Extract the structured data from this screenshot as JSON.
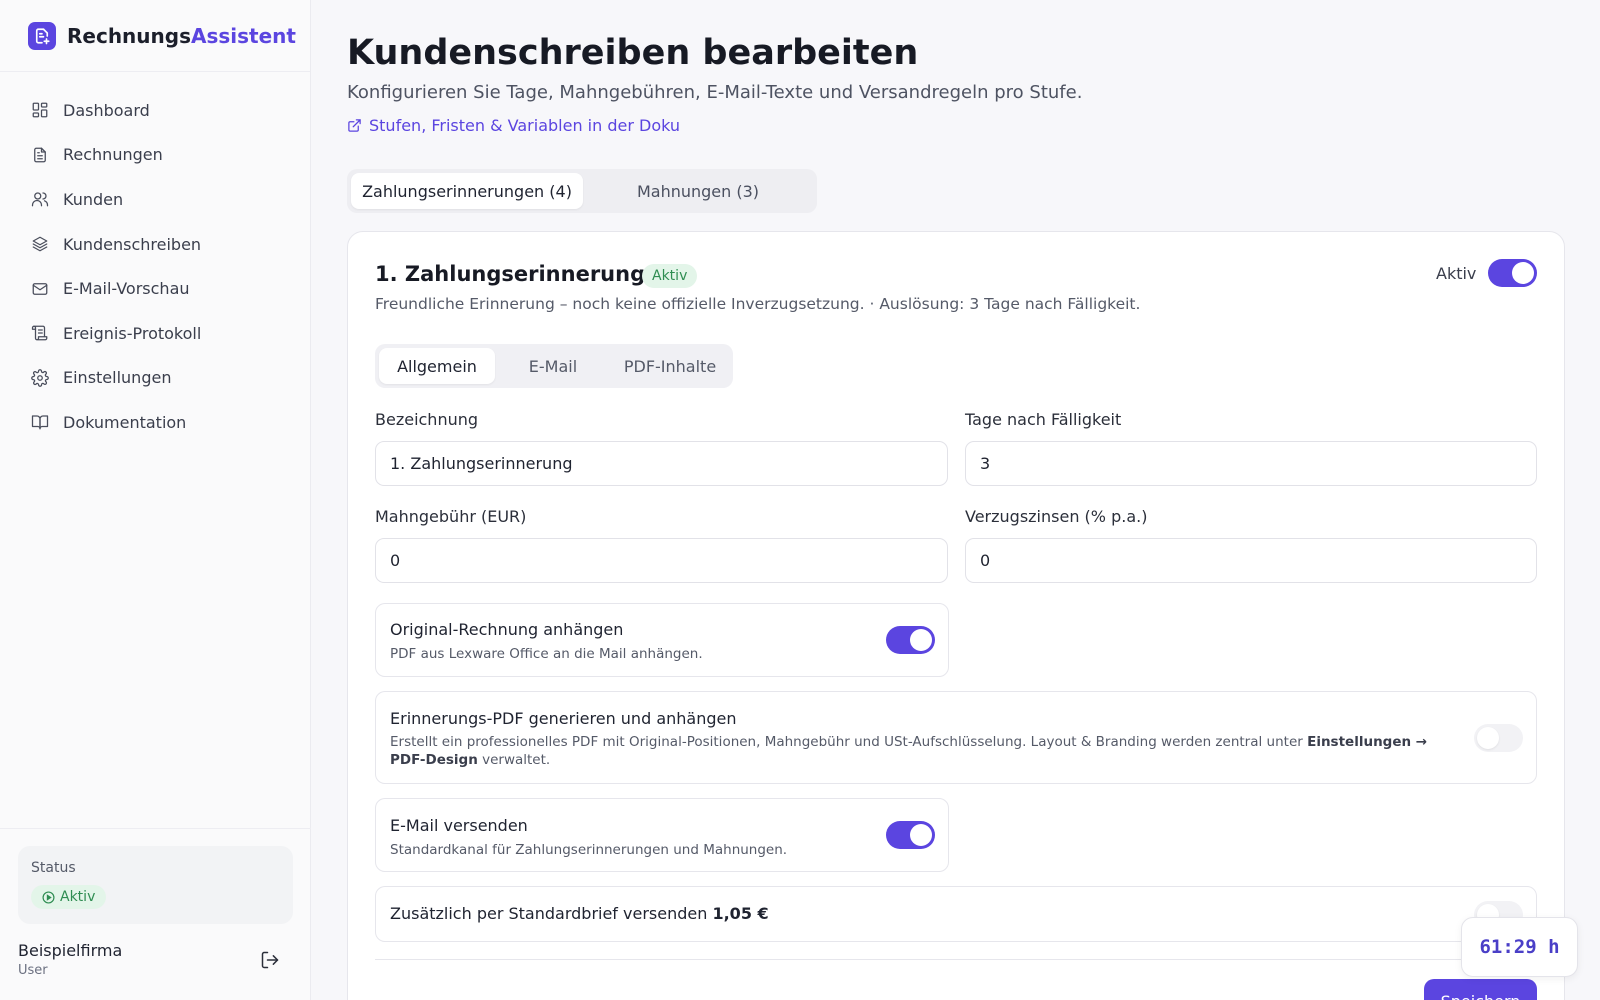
{
  "brand": {
    "name_part1": "Rechnungs",
    "name_part2": "Assistent",
    "logo_icon": "document-plus-icon"
  },
  "sidebar": {
    "items": [
      {
        "label": "Dashboard",
        "icon": "dashboard-icon"
      },
      {
        "label": "Rechnungen",
        "icon": "document-icon"
      },
      {
        "label": "Kunden",
        "icon": "users-icon"
      },
      {
        "label": "Kundenschreiben",
        "icon": "layers-icon"
      },
      {
        "label": "E-Mail-Vorschau",
        "icon": "mail-icon"
      },
      {
        "label": "Ereignis-Protokoll",
        "icon": "scroll-icon"
      },
      {
        "label": "Einstellungen",
        "icon": "gear-icon"
      },
      {
        "label": "Dokumentation",
        "icon": "book-icon"
      }
    ],
    "status": {
      "title": "Status",
      "value": "Aktiv"
    },
    "user": {
      "name": "Beispielfirma",
      "role": "User"
    }
  },
  "page": {
    "title": "Kundenschreiben bearbeiten",
    "subtitle": "Konfigurieren Sie Tage, Mahngebühren, E-Mail-Texte und Versandregeln pro Stufe.",
    "doc_link": "Stufen, Fristen & Variablen in der Doku"
  },
  "tabs": [
    {
      "label": "Zahlungserinnerungen (4)",
      "active": true
    },
    {
      "label": "Mahnungen (3)",
      "active": false
    }
  ],
  "card": {
    "title": "1. Zahlungserinnerung",
    "badge": "Aktiv",
    "description": "Freundliche Erinnerung – noch keine offizielle Inverzugsetzung. · Auslösung: 3 Tage nach Fälligkeit.",
    "active_label": "Aktiv",
    "active": true,
    "subtabs": [
      {
        "label": "Allgemein",
        "active": true
      },
      {
        "label": "E-Mail",
        "active": false
      },
      {
        "label": "PDF-Inhalte",
        "active": false
      }
    ],
    "fields": {
      "bezeichnung": {
        "label": "Bezeichnung",
        "value": "1. Zahlungserinnerung"
      },
      "tage": {
        "label": "Tage nach Fälligkeit",
        "value": "3"
      },
      "gebuehr": {
        "label": "Mahngebühr (EUR)",
        "value": "0"
      },
      "zinsen": {
        "label": "Verzugszinsen (% p.a.)",
        "value": "0"
      }
    },
    "options": {
      "attach_original": {
        "title": "Original-Rechnung anhängen",
        "desc": "PDF aus Lexware Office an die Mail anhängen.",
        "enabled": true
      },
      "reminder_pdf": {
        "title": "Erinnerungs-PDF generieren und anhängen",
        "desc_pre": "Erstellt ein professionelles PDF mit Original-Positionen, Mahngebühr und USt-Aufschlüsselung. Layout & Branding werden zentral unter ",
        "desc_bold": "Einstellungen → PDF-Design",
        "desc_post": " verwaltet.",
        "enabled": false
      },
      "send_email": {
        "title": "E-Mail versenden",
        "desc": "Standardkanal für Zahlungserinnerungen und Mahnungen.",
        "enabled": true
      },
      "letter": {
        "title_pre": "Zusätzlich per Standardbrief versenden ",
        "price": "1,05 €",
        "enabled": false
      }
    },
    "save_label": "Speichern"
  },
  "timer": "61:29 h",
  "colors": {
    "accent": "#5b45e0",
    "success": "#2f8d52",
    "success_bg": "#e3f5e9"
  }
}
